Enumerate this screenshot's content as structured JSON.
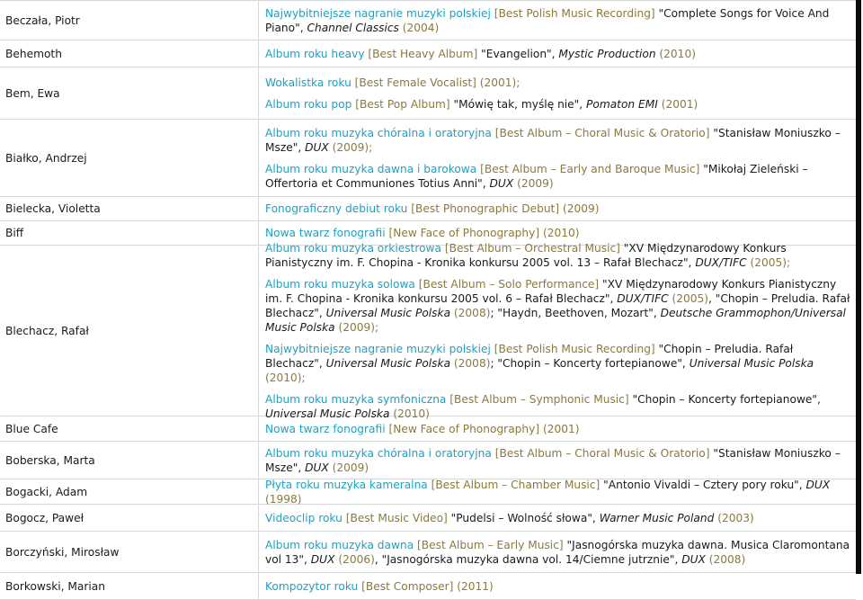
{
  "colors": {
    "category": "#1fa1c2",
    "english_and_year": "#8a7a3d",
    "text": "#1a1a1a",
    "rule": "#d8d8d8",
    "right_bar": "#0b0b0b"
  },
  "rows": [
    {
      "name": "Beczała, Piotr",
      "awards": [
        {
          "cat": "Najwybitniejsze nagranie muzyki polskiej",
          "eng": " [Best Polish Music Recording]",
          "title": " \"Complete Songs for Voice And Piano\", ",
          "label": "Channel Classics",
          "tail": "",
          "year": " (2004)"
        }
      ]
    },
    {
      "name": "Behemoth",
      "awards": [
        {
          "cat": "Album roku heavy",
          "eng": " [Best Heavy Album]",
          "title": " \"Evangelion\", ",
          "label": "Mystic Production",
          "tail": "",
          "year": " (2010)"
        }
      ]
    },
    {
      "name": "Bem, Ewa",
      "awards": [
        {
          "cat": "Wokalistka roku",
          "eng": " [Best Female Vocalist] (2001);",
          "title": "",
          "label": "",
          "tail": "",
          "year": ""
        },
        {
          "cat": "Album roku pop",
          "eng": " [Best Pop Album]",
          "title": " \"Mówię tak, myślę nie\", ",
          "label": "Pomaton EMI",
          "tail": "",
          "year": " (2001)"
        }
      ]
    },
    {
      "name": "Białko, Andrzej",
      "awards": [
        {
          "cat": "Album roku muzyka chóralna i oratoryjna",
          "eng": " [Best Album – Choral Music & Oratorio]",
          "title": " \"Stanisław Moniuszko – Msze\", ",
          "label": "DUX",
          "tail": "",
          "year": " (2009);"
        },
        {
          "cat": "Album roku muzyka dawna i barokowa",
          "eng": " [Best Album – Early and Baroque Music]",
          "title": " \"Mikołaj Zieleński – Offertoria et Communiones Totius Anni\", ",
          "label": "DUX",
          "tail": "",
          "year": " (2009)"
        }
      ]
    },
    {
      "name": "Bielecka, Violetta",
      "awards": [
        {
          "cat": "Fonograficzny debiut roku",
          "eng": " [Best Phonographic Debut] (2009)",
          "title": "",
          "label": "",
          "tail": "",
          "year": ""
        }
      ]
    },
    {
      "name": "Biff",
      "awards": [
        {
          "cat": "Nowa twarz fonografii",
          "eng": " [New Face of Phonography] (2010)",
          "title": "",
          "label": "",
          "tail": "",
          "year": ""
        }
      ]
    },
    {
      "name": "Blechacz, Rafał",
      "awards": [
        {
          "cat": "Album roku muzyka orkiestrowa",
          "eng": " [Best Album – Orchestral Music]",
          "title": " \"XV Międzynarodowy Konkurs Pianistyczny im. F. Chopina - Kronika konkursu 2005 vol. 13 – Rafał Blechacz\", ",
          "label": "DUX/TIFC",
          "tail": "",
          "year": " (2005);"
        },
        {
          "cat": "Album roku muzyka solowa",
          "eng": " [Best Album – Solo Performance]",
          "title": " \"XV Międzynarodowy Konkurs Pianistyczny im. F. Chopina - Kronika konkursu 2005 vol. 6 – Rafał Blechacz\", ",
          "label": "DUX/TIFC",
          "tail": " (2005), \"Chopin – Preludia. Rafał Blechacz\", ",
          "tail_label": "Universal Music Polska",
          "tail2": " (2008); \"Haydn, Beethoven, Mozart\", ",
          "tail2_label": "Deutsche Grammophon/Universal Music Polska",
          "year": " (2009);"
        },
        {
          "cat": "Najwybitniejsze nagranie muzyki polskiej",
          "eng": " [Best Polish Music Recording]",
          "title": " \"Chopin – Preludia. Rafał Blechacz\", ",
          "label": "Universal Music Polska",
          "tail": " (2008); \"Chopin – Koncerty fortepianowe\", ",
          "tail_label": "Universal Music Polska",
          "year": " (2010);"
        },
        {
          "cat": "Album roku muzyka symfoniczna",
          "eng": " [Best Album – Symphonic Music]",
          "title": " \"Chopin – Koncerty fortepianowe\", ",
          "label": "Universal Music Polska",
          "tail": "",
          "year": " (2010)"
        }
      ]
    },
    {
      "name": "Blue Cafe",
      "awards": [
        {
          "cat": "Nowa twarz fonografii",
          "eng": " [New Face of Phonography] (2001)",
          "title": "",
          "label": "",
          "tail": "",
          "year": ""
        }
      ]
    },
    {
      "name": "Boberska, Marta",
      "awards": [
        {
          "cat": "Album roku muzyka chóralna i oratoryjna",
          "eng": " [Best Album – Choral Music & Oratorio]",
          "title": " \"Stanisław Moniuszko – Msze\", ",
          "label": "DUX",
          "tail": "",
          "year": " (2009)"
        }
      ]
    },
    {
      "name": "Bogacki, Adam",
      "awards": [
        {
          "cat": "Płyta roku muzyka kameralna",
          "eng": " [Best Album – Chamber Music]",
          "title": " \"Antonio Vivaldi – Cztery pory roku\", ",
          "label": "DUX",
          "tail": "",
          "year": " (1998)"
        }
      ]
    },
    {
      "name": "Bogocz, Paweł",
      "awards": [
        {
          "cat": "Videoclip roku",
          "eng": " [Best Music Video]",
          "title": " \"Pudelsi – Wolność słowa\", ",
          "label": "Warner Music Poland",
          "tail": "",
          "year": " (2003)"
        }
      ]
    },
    {
      "name": "Borczyński, Mirosław",
      "awards": [
        {
          "cat": "Album roku muzyka dawna",
          "eng": " [Best Album – Early Music]",
          "title": " \"Jasnogórska muzyka dawna. Musica Claromontana vol 13\", ",
          "label": "DUX",
          "tail": " (2006), \"Jasnogórska muzyka dawna vol. 14/Ciemne jutrznie\", ",
          "tail_label": "DUX",
          "year": " (2008)"
        }
      ]
    },
    {
      "name": "Borkowski, Marian",
      "awards": [
        {
          "cat": "Kompozytor roku",
          "eng": " [Best Composer] (2011)",
          "title": "",
          "label": "",
          "tail": "",
          "year": ""
        }
      ]
    }
  ]
}
